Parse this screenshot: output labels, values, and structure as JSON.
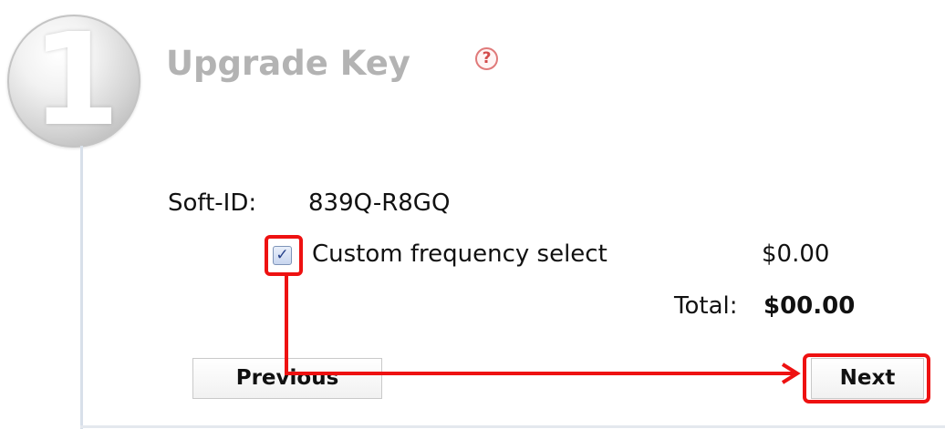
{
  "step": {
    "number": "1",
    "title": "Upgrade Key",
    "help_glyph": "?"
  },
  "softid": {
    "label": "Soft-ID:",
    "value": "839Q-R8GQ"
  },
  "option": {
    "checked": true,
    "check_glyph": "✓",
    "label": "Custom frequency select",
    "price": "$0.00"
  },
  "total": {
    "label": "Total:",
    "value": "$00.00"
  },
  "buttons": {
    "previous": "Previous",
    "next": "Next"
  },
  "colors": {
    "annotation": "#ee1111",
    "title": "#b3b3b3",
    "help": "#d24a4a"
  }
}
